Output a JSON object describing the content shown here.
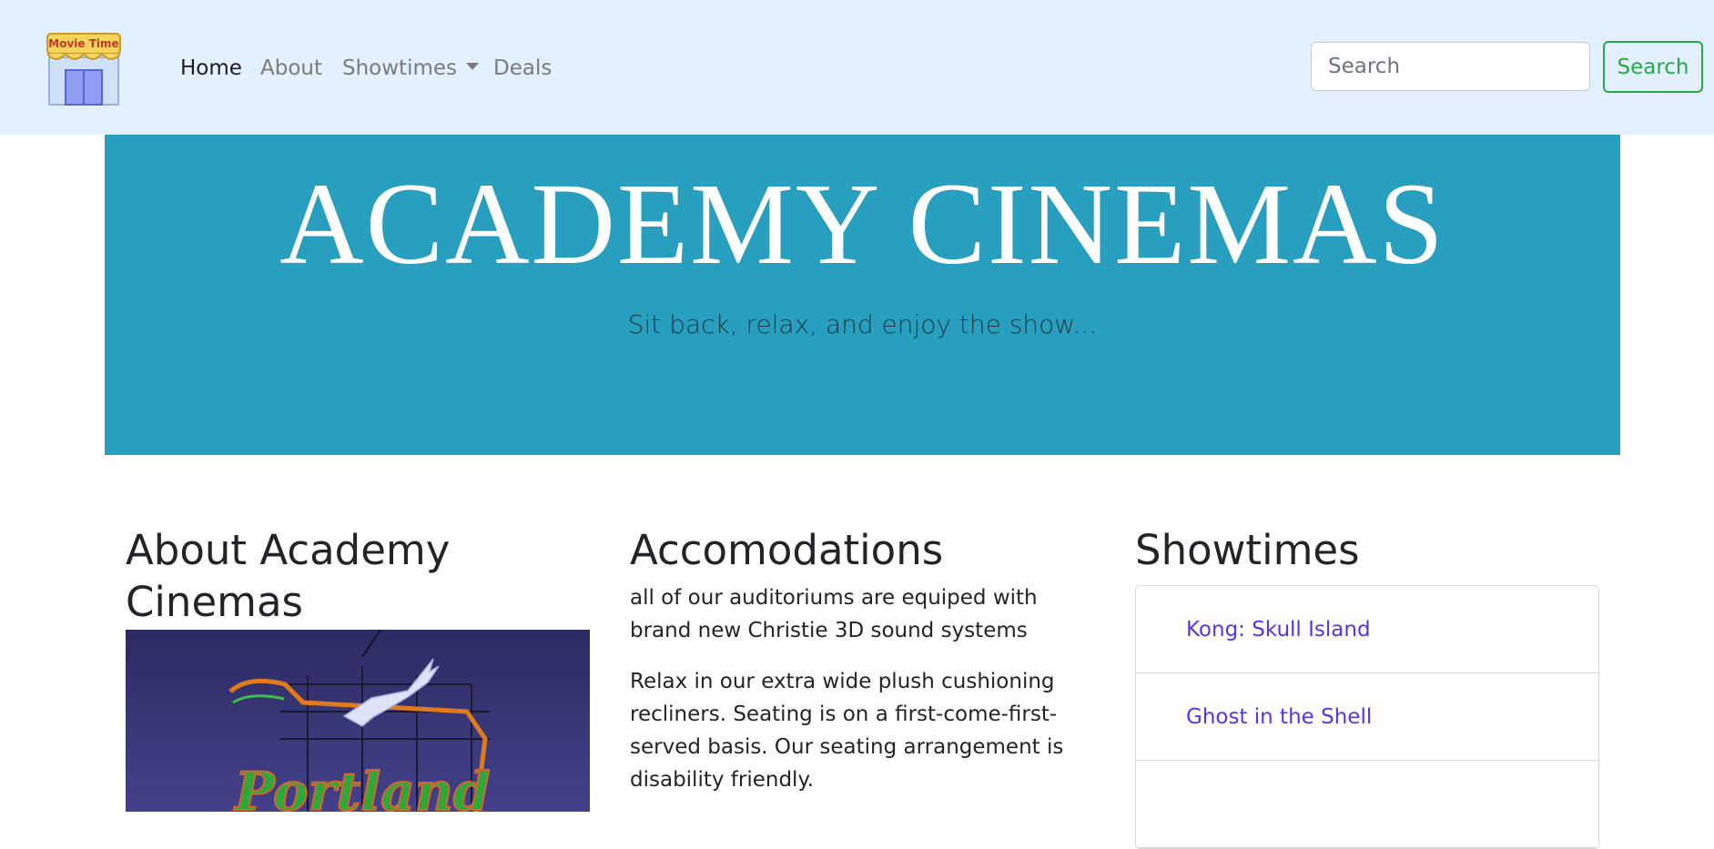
{
  "navbar": {
    "logo_text": "Movie Time",
    "links": [
      {
        "label": "Home",
        "active": true
      },
      {
        "label": "About",
        "active": false
      },
      {
        "label": "Showtimes",
        "dropdown": true
      },
      {
        "label": "Deals",
        "active": false
      }
    ],
    "search": {
      "placeholder": "Search",
      "button_label": "Search"
    }
  },
  "hero": {
    "title": "ACADEMY CINEMAS",
    "subtitle": "Sit back, relax, and enjoy the show..."
  },
  "about": {
    "heading": "About Academy Cinemas",
    "image_sign_text": "Portland"
  },
  "accommodations": {
    "heading": "Accomodations",
    "paragraphs": [
      "all of our auditoriums are equiped with brand new Christie 3D sound systems",
      "Relax in our extra wide plush cushioning recliners. Seating is on a first-come-first-served basis. Our seating arrangement is disability friendly."
    ]
  },
  "showtimes": {
    "heading": "Showtimes",
    "movies": [
      "Kong: Skull Island",
      "Ghost in the Shell",
      ""
    ]
  },
  "colors": {
    "navbar_bg": "#e3f0ff",
    "hero_bg": "#289fbe",
    "link": "#5b32e8",
    "success": "#28a745"
  }
}
